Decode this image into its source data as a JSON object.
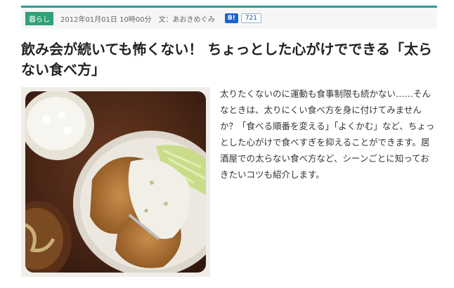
{
  "article": {
    "category": "暮らし",
    "date": "2012年01月01日 10時00分",
    "author": "文：あおきめぐみ",
    "bookmark_icon": "B!",
    "bookmark_count": "721",
    "title": "飲み会が続いても怖くない！ ちょっとした心がけでできる「太らない食べ方」",
    "excerpt": "太りたくないのに運動も食事制限も続かない……そんなときは、太りにくい食べ方を身に付けてみませんか？「食べる順番を変える」「よくかむ」など、ちょっとした心がけで食べすぎを抑えることができます。居酒屋での太らない食べ方など、シーンごとに知っておきたいコツも紹介します。"
  },
  "colors": {
    "accent": "#2a9d8f",
    "category_bg": "#2fa277",
    "bookmark_blue": "#1a64d1"
  }
}
